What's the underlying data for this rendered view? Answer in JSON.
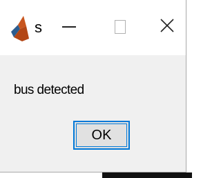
{
  "window": {
    "title": "s",
    "icon": "matlab-icon",
    "controls": {
      "minimize_icon": "minimize-icon",
      "maximize_icon": "maximize-icon",
      "close_glyph": "X"
    }
  },
  "dialog": {
    "message": "bus detected",
    "ok_label": "OK"
  },
  "colors": {
    "focus_border": "#0078d7",
    "dialog_background": "#f0f0f0",
    "titlebar_background": "#ffffff"
  }
}
